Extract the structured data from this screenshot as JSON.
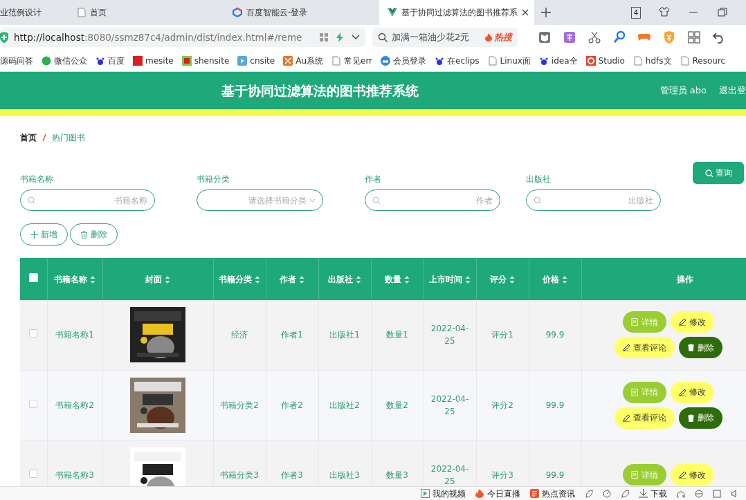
{
  "browser": {
    "tabs": [
      {
        "label": "业范例设计",
        "selected": false
      },
      {
        "label": "首页",
        "selected": false
      },
      {
        "label": "百度智能云-登录",
        "selected": false
      },
      {
        "label": "基于协同过滤算法的图书推荐系",
        "selected": true
      }
    ],
    "tab_count": "4",
    "address": {
      "host": "http://localhost",
      "rest": ":8080/ssmz87c4/admin/dist/index.html#/reme"
    },
    "search": {
      "text": "加满一箱油少花2元",
      "hot": "热搜"
    },
    "bookmarks": [
      "源码问答",
      "微信公众",
      "百度",
      "mesite",
      "shensite",
      "cnsite",
      "Au系统",
      "常见err",
      "会员登录",
      "在eclips",
      "Linux面",
      "idea全",
      "Studio",
      "hdfs文",
      "Resourc"
    ]
  },
  "app": {
    "title": "基于协同过滤算法的图书推荐系统",
    "user": "管理员 abo",
    "logout": "退出登"
  },
  "breadcrumb": [
    "首页",
    "热门图书"
  ],
  "filters": [
    {
      "label": "书籍名称",
      "placeholder": "书籍名称",
      "kind": "input"
    },
    {
      "label": "书籍分类",
      "placeholder": "请选择书籍分类",
      "kind": "select"
    },
    {
      "label": "作者",
      "placeholder": "作者",
      "kind": "input"
    },
    {
      "label": "出版社",
      "placeholder": "出版社",
      "kind": "input"
    }
  ],
  "query_button": "查询",
  "toolbar": [
    {
      "label": "新增",
      "kind": "add"
    },
    {
      "label": "删除",
      "kind": "delete"
    }
  ],
  "table": {
    "select_all": {
      "checked": false
    },
    "columns": [
      {
        "label": "书籍名称",
        "sortable": true
      },
      {
        "label": "封面",
        "sortable": true
      },
      {
        "label": "书籍分类",
        "sortable": true
      },
      {
        "label": "作者",
        "sortable": true
      },
      {
        "label": "出版社",
        "sortable": true
      },
      {
        "label": "数量",
        "sortable": true
      },
      {
        "label": "上市时间",
        "sortable": true
      },
      {
        "label": "评分",
        "sortable": true
      },
      {
        "label": "价格",
        "sortable": true
      },
      {
        "label": "操作",
        "sortable": false
      }
    ],
    "rows": [
      {
        "checked": false,
        "cells": [
          "书籍名称1",
          "",
          "经济",
          "作者1",
          "出版社1",
          "数量1",
          "2022-04-25",
          "评分1",
          "99.9"
        ],
        "cover": {
          "kind": "picture"
        },
        "actions": [
          {
            "label": "详情",
            "kind": "detail"
          },
          {
            "label": "修改",
            "kind": "edit"
          },
          {
            "label": "查看评论",
            "kind": "review"
          },
          {
            "label": "删除",
            "kind": "delete"
          }
        ]
      },
      {
        "checked": false,
        "cells": [
          "书籍名称2",
          "",
          "书籍分类2",
          "作者2",
          "出版社2",
          "数量2",
          "2022-04-25",
          "评分2",
          "99.9"
        ],
        "cover": {
          "kind": "picture"
        },
        "actions": [
          {
            "label": "详情",
            "kind": "detail"
          },
          {
            "label": "修改",
            "kind": "edit"
          },
          {
            "label": "查看评论",
            "kind": "review"
          },
          {
            "label": "删除",
            "kind": "delete"
          }
        ]
      },
      {
        "checked": false,
        "cells": [
          "书籍名称3",
          "",
          "书籍分类3",
          "作者3",
          "出版社3",
          "数量3",
          "2022-04-25",
          "评分3",
          "99.9"
        ],
        "cover": {
          "kind": "picture"
        },
        "actions": [
          {
            "label": "详情",
            "kind": "detail"
          },
          {
            "label": "修改",
            "kind": "edit"
          }
        ]
      }
    ]
  },
  "status_bar": [
    {
      "label": "我的视频",
      "kind": "video"
    },
    {
      "label": "今日直播",
      "kind": "fire"
    },
    {
      "label": "热点资讯",
      "kind": "news"
    },
    {
      "label": "下载",
      "kind": "download"
    }
  ]
}
